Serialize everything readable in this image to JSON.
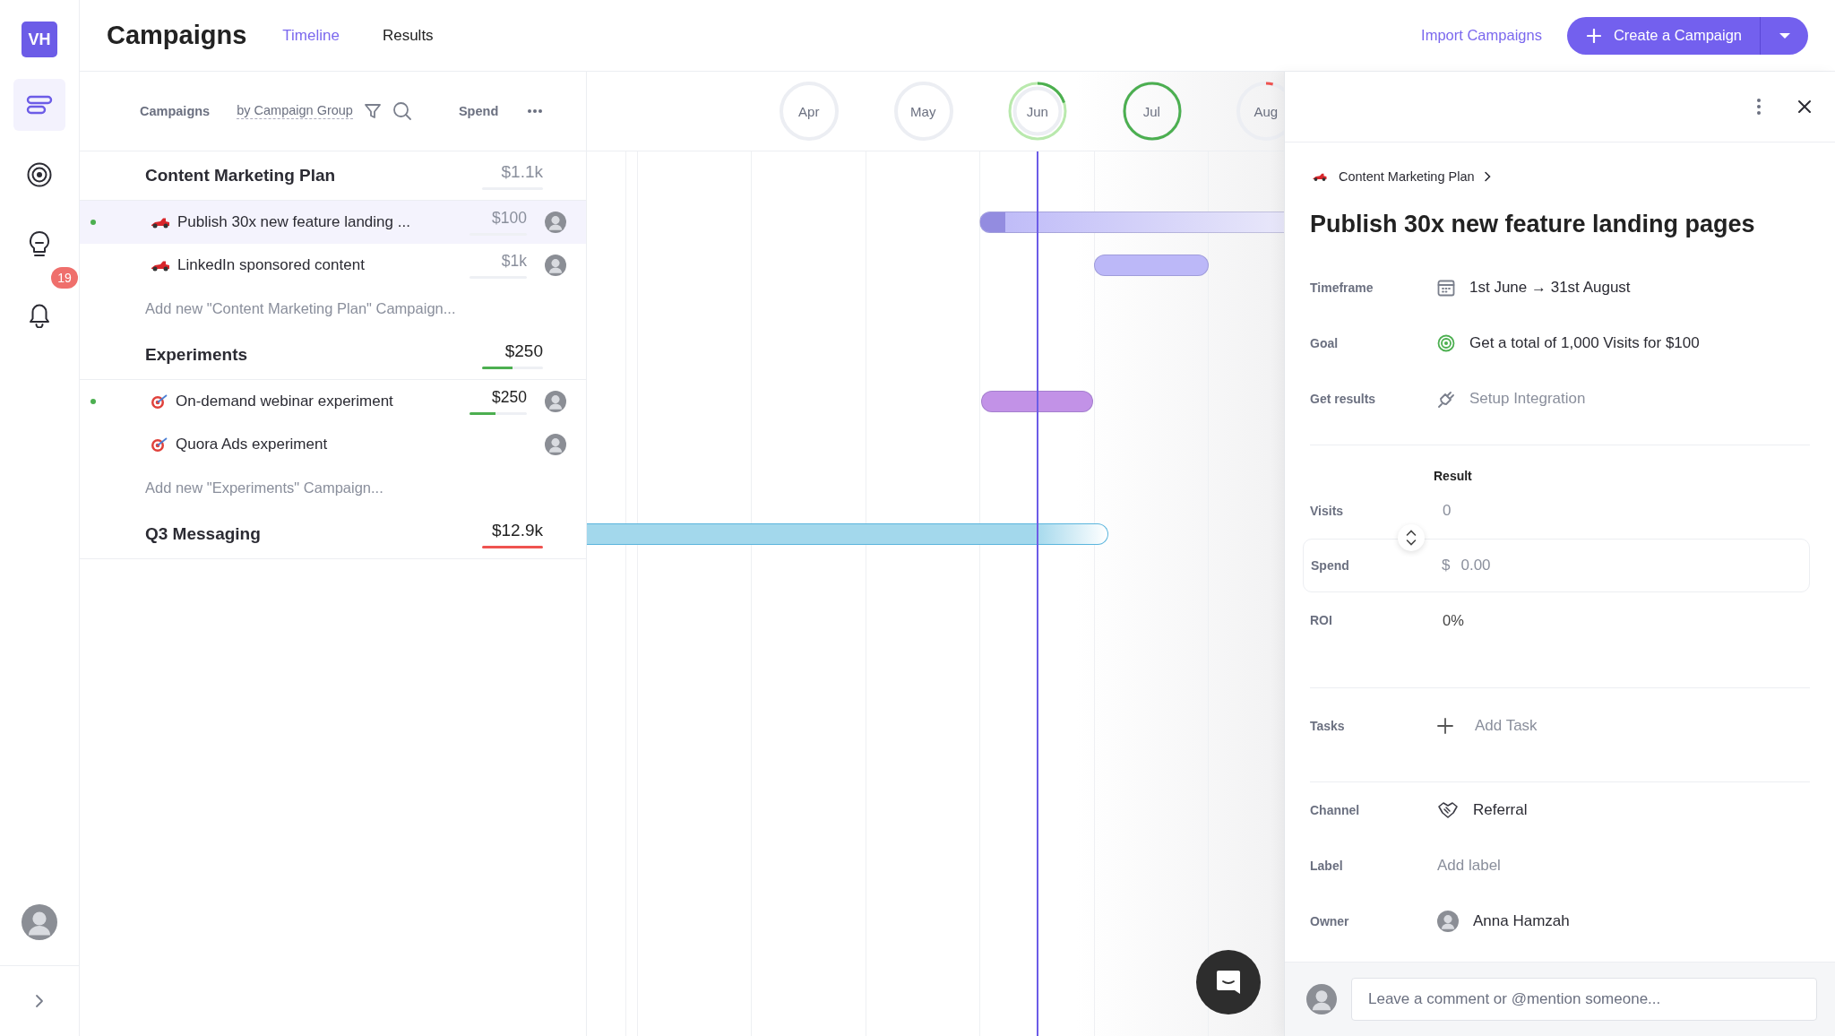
{
  "sidebar": {
    "logo": "VH",
    "items": [
      {
        "kind": "timeline",
        "selected": true
      },
      {
        "kind": "goals",
        "selected": false
      },
      {
        "kind": "ideas",
        "selected": false
      },
      {
        "kind": "notifications",
        "selected": false,
        "badge": "19"
      }
    ]
  },
  "header": {
    "title": "Campaigns",
    "tabs": [
      {
        "label": "Timeline",
        "selected": true
      },
      {
        "label": "Results",
        "selected": false
      }
    ],
    "import_link": "Import Campaigns",
    "create_button": "Create a Campaign"
  },
  "list": {
    "header": {
      "label": "Campaigns",
      "grouping": "by Campaign Group",
      "spend_label": "Spend"
    },
    "groups": [
      {
        "name": "Content Marketing Plan",
        "color": "#bcb8f8",
        "spend": {
          "amount": "$1.1k",
          "level": 0
        },
        "campaigns": [
          {
            "kind": "car",
            "name": "Publish 30x new feature landing ...",
            "spend": {
              "amount": "$100",
              "level": 0
            },
            "active": true,
            "selected": true
          },
          {
            "kind": "car",
            "name": "LinkedIn sponsored content",
            "spend": {
              "amount": "$1k",
              "level": 0
            },
            "active": false,
            "selected": false
          }
        ],
        "add_text": "Add new \"Content Marketing Plan\" Campaign..."
      },
      {
        "name": "Experiments",
        "color": "#c292e7",
        "spend": {
          "amount": "$250",
          "level": 0.5,
          "color": "#4caf50"
        },
        "campaigns": [
          {
            "kind": "dart",
            "name": "On-demand webinar experiment",
            "spend": {
              "amount": "$250",
              "level": 0.45,
              "color": "#4caf50"
            },
            "active": true,
            "selected": false
          },
          {
            "kind": "dart",
            "name": "Quora Ads experiment",
            "active": false,
            "selected": false
          }
        ],
        "add_text": "Add new \"Experiments\" Campaign..."
      },
      {
        "name": "Q3 Messaging",
        "color": "#a3d8ec",
        "spend": {
          "amount": "$12.9k",
          "level": 1,
          "color": "#ef5350"
        }
      }
    ]
  },
  "timeline": {
    "months": [
      {
        "label": "Apr",
        "current": false
      },
      {
        "label": "May",
        "current": false
      },
      {
        "label": "Jun",
        "level": 0.2,
        "color": "#4caf50",
        "current": true
      },
      {
        "label": "Jul",
        "level": 1,
        "color": "#4caf50",
        "current": false
      },
      {
        "label": "Aug",
        "level": 0.04,
        "color": "#ef5350",
        "current": false
      }
    ]
  },
  "details": {
    "breadcrumb": "Content Marketing Plan",
    "title": "Publish 30x new feature landing pages",
    "fields": [
      {
        "kind": "date",
        "label": "Timeframe",
        "value": "1st June → 31st August"
      },
      {
        "kind": "goal",
        "label": "Goal",
        "value": "Get a total of 1,000 Visits for $100"
      },
      {
        "kind": "integration",
        "label": "Get results",
        "action": "Setup Integration"
      }
    ],
    "result": {
      "heading": "Result",
      "rows": [
        {
          "kind": "text",
          "label": "Visits",
          "value": "0"
        },
        {
          "kind": "input",
          "label": "Spend",
          "currency": "$",
          "placeholder": "0.00"
        },
        {
          "kind": "text",
          "label": "ROI",
          "value": "0%"
        }
      ]
    },
    "tasks": {
      "label": "Tasks",
      "action": "Add Task"
    },
    "channel": {
      "label": "Channel",
      "value": "Referral"
    },
    "label_field": {
      "label": "Label",
      "action": "Add label"
    },
    "owner": {
      "label": "Owner",
      "name": "Anna Hamzah"
    },
    "comment": {
      "placeholder": "Leave a comment or @mention someone..."
    }
  }
}
